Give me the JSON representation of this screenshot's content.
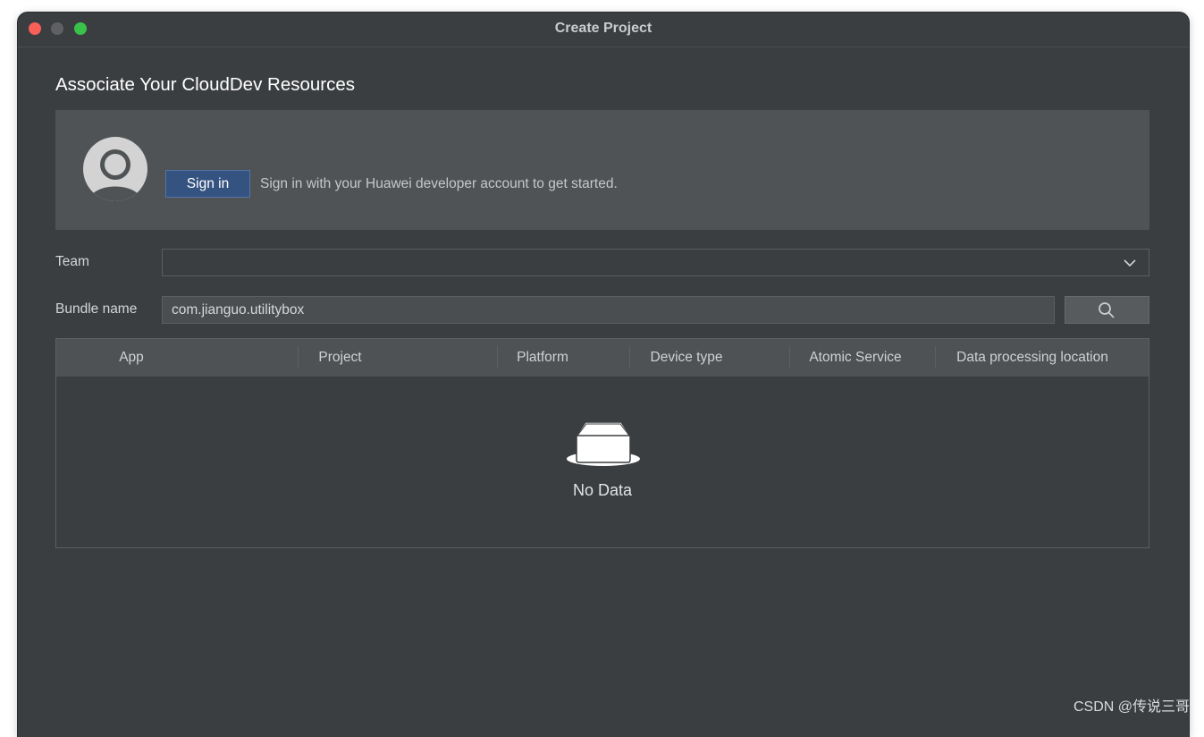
{
  "window": {
    "title": "Create Project"
  },
  "section": {
    "heading": "Associate Your CloudDev Resources"
  },
  "signin": {
    "button_label": "Sign in",
    "hint": "Sign in with your Huawei developer account to get started."
  },
  "team": {
    "label": "Team",
    "selected_value": ""
  },
  "bundle": {
    "label": "Bundle name",
    "value": "com.jianguo.utilitybox"
  },
  "table": {
    "columns": [
      "App",
      "Project",
      "Platform",
      "Device type",
      "Atomic Service",
      "Data processing location"
    ],
    "rows": [],
    "empty_text": "No Data"
  },
  "icons": {
    "avatar": "user-avatar-icon",
    "team_dropdown": "chevron-down-icon",
    "search": "search-icon",
    "empty": "empty-inbox-icon"
  },
  "colors": {
    "window_bg": "#3b3e41",
    "panel_bg": "#505355",
    "primary_button": "#355381",
    "close": "#f75f58",
    "zoom": "#3ac14a"
  },
  "watermark": "CSDN @传说三哥"
}
